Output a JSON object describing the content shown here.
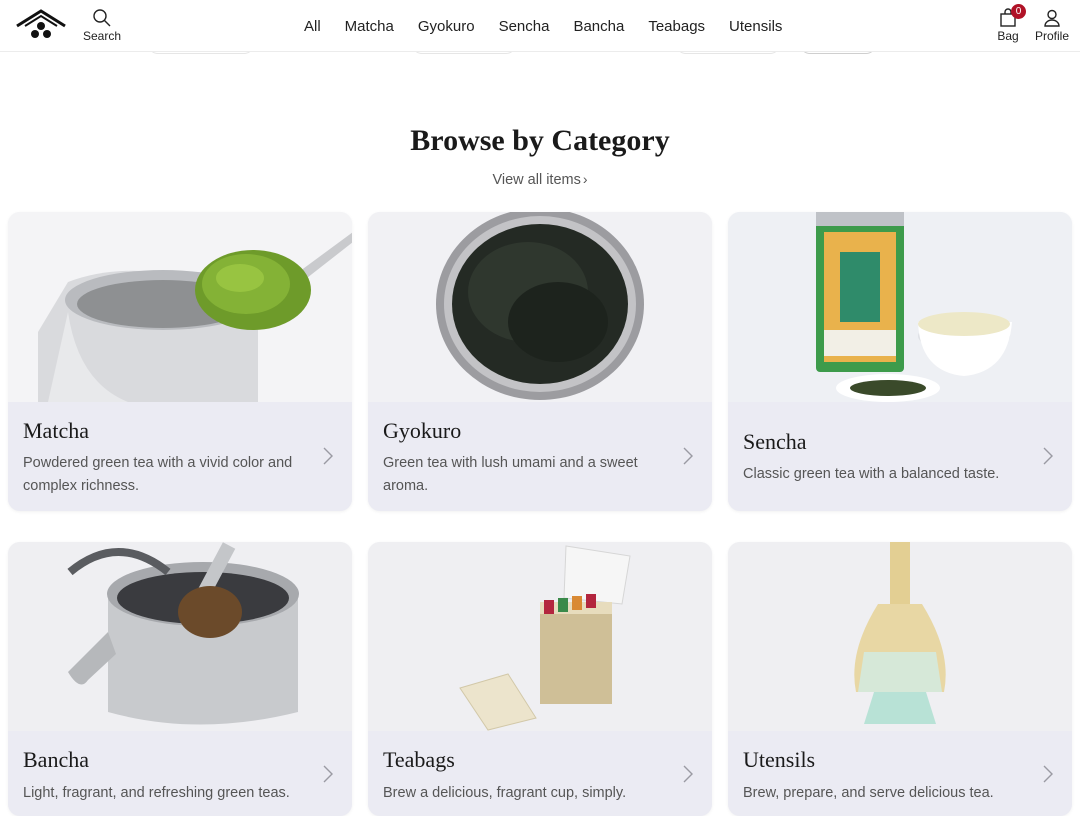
{
  "header": {
    "search_label": "Search",
    "nav": [
      "All",
      "Matcha",
      "Gyokuro",
      "Sencha",
      "Bancha",
      "Teabags",
      "Utensils"
    ],
    "bag_label": "Bag",
    "bag_count": "0",
    "profile_label": "Profile"
  },
  "section": {
    "title": "Browse by Category",
    "view_all": "View all items"
  },
  "categories": [
    {
      "title": "Matcha",
      "desc": "Powdered green tea with a vivid color and complex richness.",
      "image": "matcha-tin-with-spoon"
    },
    {
      "title": "Gyokuro",
      "desc": "Green tea with lush umami and a sweet aroma.",
      "image": "gyokuro-leaves-on-plate"
    },
    {
      "title": "Sencha",
      "desc": "Classic green tea with a balanced taste.",
      "image": "sencha-tea-tin-and-cup"
    },
    {
      "title": "Bancha",
      "desc": "Light, fragrant, and refreshing green teas.",
      "image": "bancha-kettle"
    },
    {
      "title": "Teabags",
      "desc": "Brew a delicious, fragrant cup, simply.",
      "image": "teabag-box"
    },
    {
      "title": "Utensils",
      "desc": "Brew, prepare, and serve delicious tea.",
      "image": "bamboo-whisk"
    }
  ],
  "colors": {
    "badge": "#b01227",
    "card_bg": "#ebebf3"
  }
}
